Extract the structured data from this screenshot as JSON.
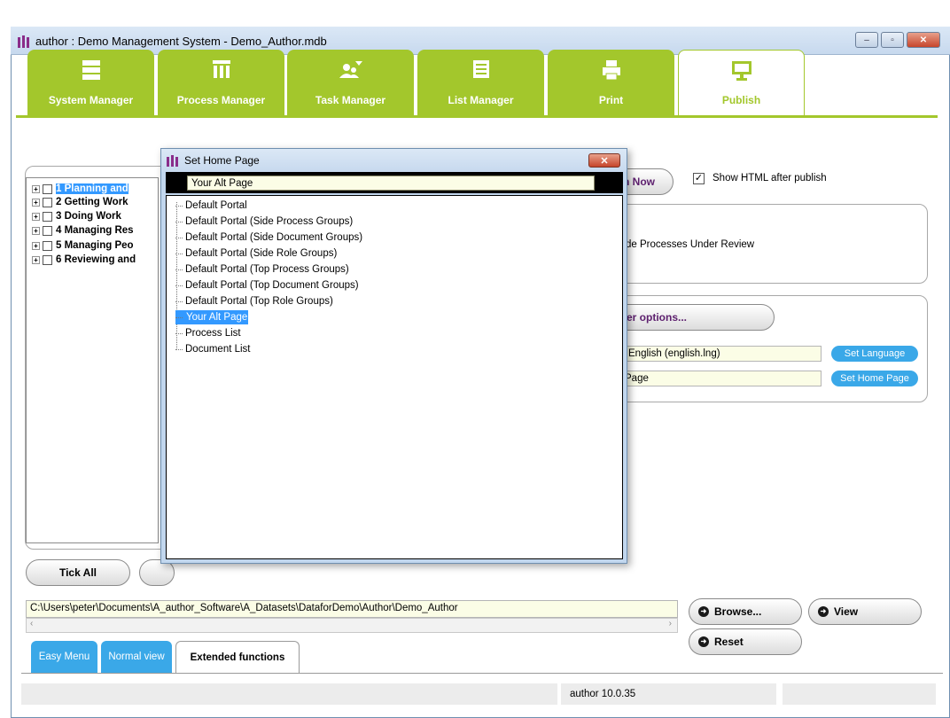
{
  "window": {
    "title": "author : Demo Management System - Demo_Author.mdb",
    "controls": {
      "minimize": "–",
      "maximize": "▫",
      "close": "✕"
    }
  },
  "top_tabs": [
    {
      "label": "System Manager",
      "icon": "stack-icon"
    },
    {
      "label": "Process Manager",
      "icon": "columns-icon"
    },
    {
      "label": "Task Manager",
      "icon": "person-task-icon"
    },
    {
      "label": "List Manager",
      "icon": "list-icon"
    },
    {
      "label": "Print",
      "icon": "printer-icon"
    },
    {
      "label": "Publish",
      "icon": "monitor-icon",
      "active": true
    }
  ],
  "tree": {
    "items": [
      {
        "label": "1 Planning and",
        "selected": true
      },
      {
        "label": "2 Getting Work"
      },
      {
        "label": "3 Doing Work"
      },
      {
        "label": "4 Managing Res"
      },
      {
        "label": "5 Managing Peo"
      },
      {
        "label": "6 Reviewing and"
      }
    ]
  },
  "publish": {
    "publish_now_label": "h Now",
    "show_html_label": "Show HTML after publish",
    "show_html_checked": true,
    "review_option_label": "de Processes Under Review",
    "other_options_label": "er options...",
    "language_value": "English  (english.lng)",
    "set_language_label": "Set Language",
    "home_page_value": "Page",
    "set_home_page_label": "Set Home Page"
  },
  "buttons": {
    "tick_all": "Tick All",
    "browse": "Browse...",
    "view": "View",
    "reset": "Reset"
  },
  "path_value": "C:\\Users\\peter\\Documents\\A_author_Software\\A_Datasets\\DataforDemo\\Author\\Demo_Author",
  "bottom_tabs": {
    "easy_menu": "Easy Menu",
    "normal_view": "Normal view",
    "extended_functions": "Extended functions"
  },
  "status": {
    "version": "author 10.0.35"
  },
  "dialog": {
    "title": "Set Home Page",
    "close": "✕",
    "input_value": "Your Alt Page",
    "options": [
      {
        "label": "Default Portal"
      },
      {
        "label": "Default Portal (Side Process Groups)"
      },
      {
        "label": "Default Portal (Side Document Groups)"
      },
      {
        "label": "Default Portal (Side Role Groups)"
      },
      {
        "label": "Default Portal (Top Process Groups)"
      },
      {
        "label": "Default Portal (Top Document Groups)"
      },
      {
        "label": "Default Portal (Top Role Groups)"
      },
      {
        "label": "Your Alt Page",
        "selected": true
      },
      {
        "label": "Process List"
      },
      {
        "label": "Document List"
      }
    ]
  },
  "colors": {
    "accent_green": "#a3c72c",
    "accent_blue": "#3aa8e8",
    "purple": "#5d1f6e"
  }
}
